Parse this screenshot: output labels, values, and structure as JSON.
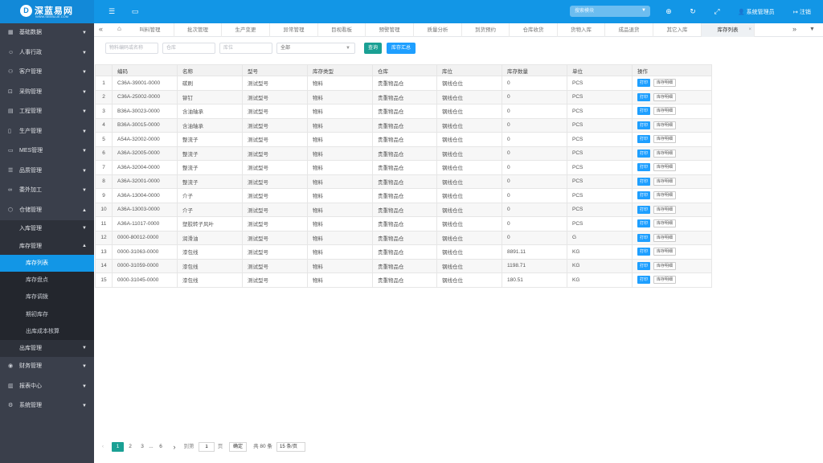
{
  "brand": {
    "badge": "D",
    "name": "深蓝易网",
    "site": "WWW.SEEBLUE.COM"
  },
  "topbar": {
    "search_placeholder": "搜索模块",
    "user": "系统管理员",
    "logout": "注销",
    "icons": [
      "menu-fold-icon",
      "window-icon",
      "globe-icon",
      "refresh-icon",
      "fullscreen-icon",
      "user-icon",
      "logout-icon"
    ]
  },
  "sidebar": {
    "items_top": [
      "基础数据",
      "人事行政",
      "客户管理",
      "采购管理",
      "工程管理",
      "生产管理",
      "MES管理",
      "品质管理",
      "委外加工"
    ],
    "warehouse": "仓储管理",
    "inbound": "入库管理",
    "inventory": "库存管理",
    "leaves": [
      "库存列表",
      "库存盘点",
      "库存调拨",
      "期初库存",
      "出库成本核算"
    ],
    "outbound": "出库管理",
    "items_bottom": [
      "财务管理",
      "报表中心",
      "系统管理"
    ]
  },
  "tabs": [
    "叫料管理",
    "批次管理",
    "生产变更",
    "异常管理",
    "目视看板",
    "预警管理",
    "质量分析",
    "到货预约",
    "仓库收货",
    "货物入库",
    "成品退货",
    "其它入库",
    "库存列表"
  ],
  "filter": {
    "code_placeholder": "物料编码或名称",
    "warehouse_placeholder": "仓库",
    "location_placeholder": "库位",
    "type_value": "全部",
    "query_label": "查询",
    "summary_label": "库存汇总"
  },
  "table": {
    "columns": [
      "",
      "编码",
      "名称",
      "型号",
      "库存类型",
      "仓库",
      "库位",
      "库存数量",
      "单位",
      "操作"
    ],
    "print_label": "打印",
    "detail_label": "库存明细",
    "rows": [
      [
        "1",
        "C36A-39001-0000",
        "碳刷",
        "测试型号",
        "物料",
        "贵重物品仓",
        "钢线仓位",
        "0",
        "PCS"
      ],
      [
        "2",
        "C36A-25002-0000",
        "铆钉",
        "测试型号",
        "物料",
        "贵重物品仓",
        "钢线仓位",
        "0",
        "PCS"
      ],
      [
        "3",
        "B36A-30023-0000",
        "含油轴承",
        "测试型号",
        "物料",
        "贵重物品仓",
        "钢线仓位",
        "0",
        "PCS"
      ],
      [
        "4",
        "B36A-30015-0000",
        "含油轴承",
        "测试型号",
        "物料",
        "贵重物品仓",
        "钢线仓位",
        "0",
        "PCS"
      ],
      [
        "5",
        "A54A-32002-0000",
        "整流子",
        "测试型号",
        "物料",
        "贵重物品仓",
        "钢线仓位",
        "0",
        "PCS"
      ],
      [
        "6",
        "A36A-32005-0000",
        "整流子",
        "测试型号",
        "物料",
        "贵重物品仓",
        "钢线仓位",
        "0",
        "PCS"
      ],
      [
        "7",
        "A36A-32004-0000",
        "整流子",
        "测试型号",
        "物料",
        "贵重物品仓",
        "钢线仓位",
        "0",
        "PCS"
      ],
      [
        "8",
        "A36A-32001-0000",
        "整流子",
        "测试型号",
        "物料",
        "贵重物品仓",
        "钢线仓位",
        "0",
        "PCS"
      ],
      [
        "9",
        "A36A-13004-0000",
        "介子",
        "测试型号",
        "物料",
        "贵重物品仓",
        "钢线仓位",
        "0",
        "PCS"
      ],
      [
        "10",
        "A36A-13003-0000",
        "介子",
        "测试型号",
        "物料",
        "贵重物品仓",
        "钢线仓位",
        "0",
        "PCS"
      ],
      [
        "11",
        "A36A-11017-0000",
        "塑胶转子风叶",
        "测试型号",
        "物料",
        "贵重物品仓",
        "钢线仓位",
        "0",
        "PCS"
      ],
      [
        "12",
        "0000-80012-0000",
        "润滑油",
        "测试型号",
        "物料",
        "贵重物品仓",
        "钢线仓位",
        "0",
        "G"
      ],
      [
        "13",
        "0000-31063-0000",
        "漆包线",
        "测试型号",
        "物料",
        "贵重物品仓",
        "钢线仓位",
        "8891.11",
        "KG"
      ],
      [
        "14",
        "0000-31059-0000",
        "漆包线",
        "测试型号",
        "物料",
        "贵重物品仓",
        "钢线仓位",
        "1198.71",
        "KG"
      ],
      [
        "15",
        "0000-31045-0000",
        "漆包线",
        "测试型号",
        "物料",
        "贵重物品仓",
        "钢线仓位",
        "180.51",
        "KG"
      ]
    ]
  },
  "pager": {
    "prev": "‹",
    "p1": "1",
    "p2": "2",
    "p3": "3",
    "ellipsis": "...",
    "plast": "6",
    "next": "›",
    "goto": "到第",
    "goto_value": "1",
    "page_unit": "页",
    "confirm": "确定",
    "total": "共 80 条",
    "per_page": "15 条/页"
  }
}
